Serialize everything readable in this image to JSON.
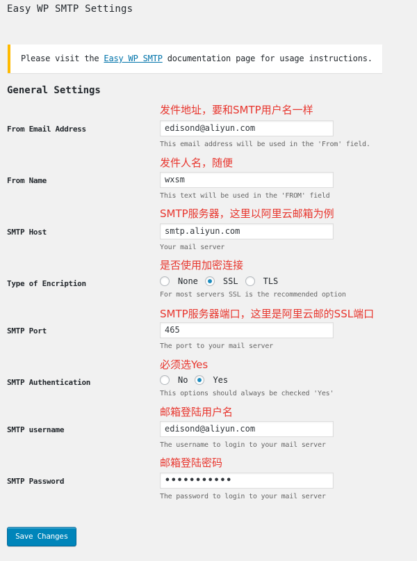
{
  "page": {
    "title": "Easy WP SMTP Settings"
  },
  "notice": {
    "text_before": "Please visit the ",
    "link": "Easy WP SMTP",
    "text_after": " documentation page for usage instructions."
  },
  "section": {
    "title": "General Settings"
  },
  "annotations": {
    "from_email": "发件地址，要和SMTP用户名一样",
    "from_name": "发件人名，随便",
    "smtp_host": "SMTP服务器，这里以阿里云邮箱为例",
    "encryption": "是否使用加密连接",
    "smtp_port": "SMTP服务器端口，这里是阿里云邮的SSL端口",
    "authentication": "必须选Yes",
    "username": "邮箱登陆用户名",
    "password": "邮箱登陆密码"
  },
  "fields": {
    "from_email": {
      "label": "From Email Address",
      "value": "edisond@aliyun.com",
      "description": "This email address will be used in the 'From' field."
    },
    "from_name": {
      "label": "From Name",
      "value": "wxsm",
      "description": "This text will be used in the 'FROM' field"
    },
    "smtp_host": {
      "label": "SMTP Host",
      "value": "smtp.aliyun.com",
      "description": "Your mail server"
    },
    "encryption": {
      "label": "Type of Encription",
      "options": [
        "None",
        "SSL",
        "TLS"
      ],
      "selected": "SSL",
      "description": "For most servers SSL is the recommended option"
    },
    "smtp_port": {
      "label": "SMTP Port",
      "value": "465",
      "description": "The port to your mail server"
    },
    "authentication": {
      "label": "SMTP Authentication",
      "options": [
        "No",
        "Yes"
      ],
      "selected": "Yes",
      "description": "This options should always be checked 'Yes'"
    },
    "username": {
      "label": "SMTP username",
      "value": "edisond@aliyun.com",
      "description": "The username to login to your mail server"
    },
    "password": {
      "label": "SMTP Password",
      "value": "•••••••••••",
      "description": "The password to login to your mail server"
    }
  },
  "buttons": {
    "save": "Save Changes"
  },
  "colors": {
    "annotation": "#e8352d",
    "primary_button": "#0085ba",
    "notice_border": "#ffba00",
    "link": "#0073aa"
  }
}
